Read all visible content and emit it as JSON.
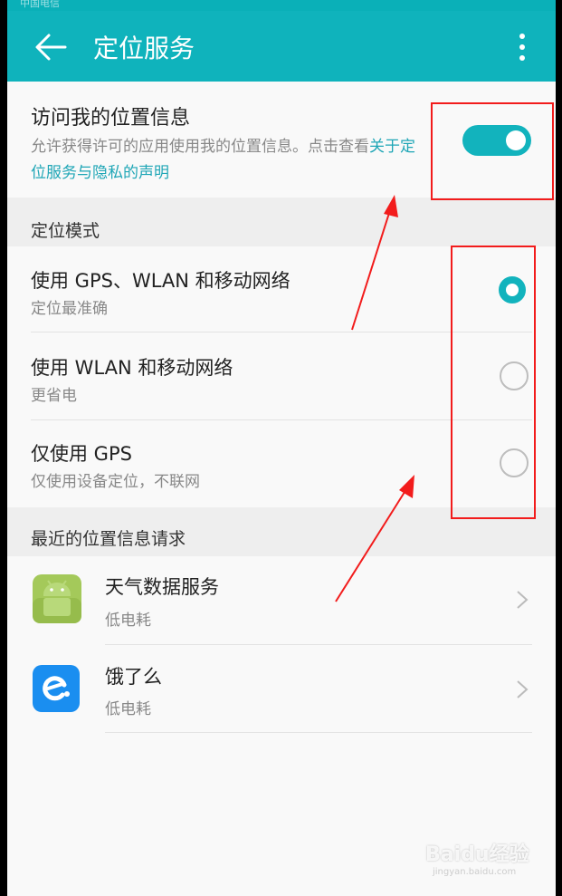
{
  "status_bar": {
    "carrier": "中国电信"
  },
  "app_bar": {
    "title": "定位服务",
    "back_icon": "arrow-left-icon",
    "more_icon": "more-vertical-icon"
  },
  "access_location": {
    "title": "访问我的位置信息",
    "desc_prefix": "允许获得许可的应用使用我的位置信息。点击查看",
    "desc_link": "关于定位服务与隐私的声明",
    "toggle_on": true
  },
  "mode_section": {
    "label": "定位模式",
    "options": [
      {
        "title": "使用 GPS、WLAN 和移动网络",
        "subtitle": "定位最准确",
        "selected": true
      },
      {
        "title": "使用 WLAN 和移动网络",
        "subtitle": "更省电",
        "selected": false
      },
      {
        "title": "仅使用 GPS",
        "subtitle": "仅使用设备定位，不联网",
        "selected": false
      }
    ]
  },
  "recent_section": {
    "label": "最近的位置信息请求",
    "apps": [
      {
        "name": "天气数据服务",
        "usage": "低电耗",
        "icon": "android-icon"
      },
      {
        "name": "饿了么",
        "usage": "低电耗",
        "icon": "eleme-icon"
      }
    ]
  },
  "watermark": {
    "brand": "Baidu经验",
    "url": "jingyan.baidu.com"
  },
  "colors": {
    "accent": "#12b3bd",
    "appbar": "#0fb3bc",
    "annotation": "#f21c1c",
    "link": "#1fa6b6"
  }
}
